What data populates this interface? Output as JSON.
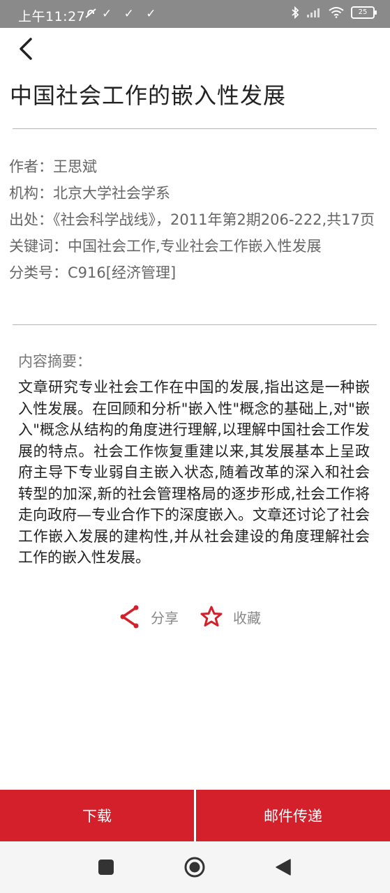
{
  "status_bar": {
    "time": "上午11:27",
    "left_icons": "✓ ✓ ✓",
    "battery": "25"
  },
  "title": "中国社会工作的嵌入性发展",
  "meta": {
    "author": "作者：王思斌",
    "institution": "机构：北京大学社会学系",
    "source": "出处：《社会科学战线》，2011年第2期206-222,共17页",
    "keywords": "关键词：中国社会工作,专业社会工作嵌入性发展",
    "classification": "分类号：C916[经济管理]"
  },
  "abstract": {
    "label": "内容摘要：",
    "text": "文章研究专业社会工作在中国的发展,指出这是一种嵌入性发展。在回顾和分析\"嵌入性\"概念的基础上,对\"嵌入\"概念从结构的角度进行理解,以理解中国社会工作发展的特点。社会工作恢复重建以来,其发展基本上呈政府主导下专业弱自主嵌入状态,随着改革的深入和社会转型的加深,新的社会管理格局的逐步形成,社会工作将走向政府—专业合作下的深度嵌入。文章还讨论了社会工作嵌入发展的建构性,并从社会建设的角度理解社会工作的嵌入性发展。"
  },
  "actions": {
    "share_label": "分享",
    "favorite_label": "收藏"
  },
  "bottom": {
    "download_label": "下载",
    "email_label": "邮件传递"
  },
  "colors": {
    "accent": "#d4202b",
    "status_bar": "#8a8a8a"
  },
  "icons": [
    "back-arrow-icon",
    "share-icon",
    "star-icon",
    "bluetooth-icon",
    "signal-icon",
    "wifi-icon",
    "battery-icon",
    "nav-square-icon",
    "nav-home-icon",
    "nav-back-icon"
  ]
}
